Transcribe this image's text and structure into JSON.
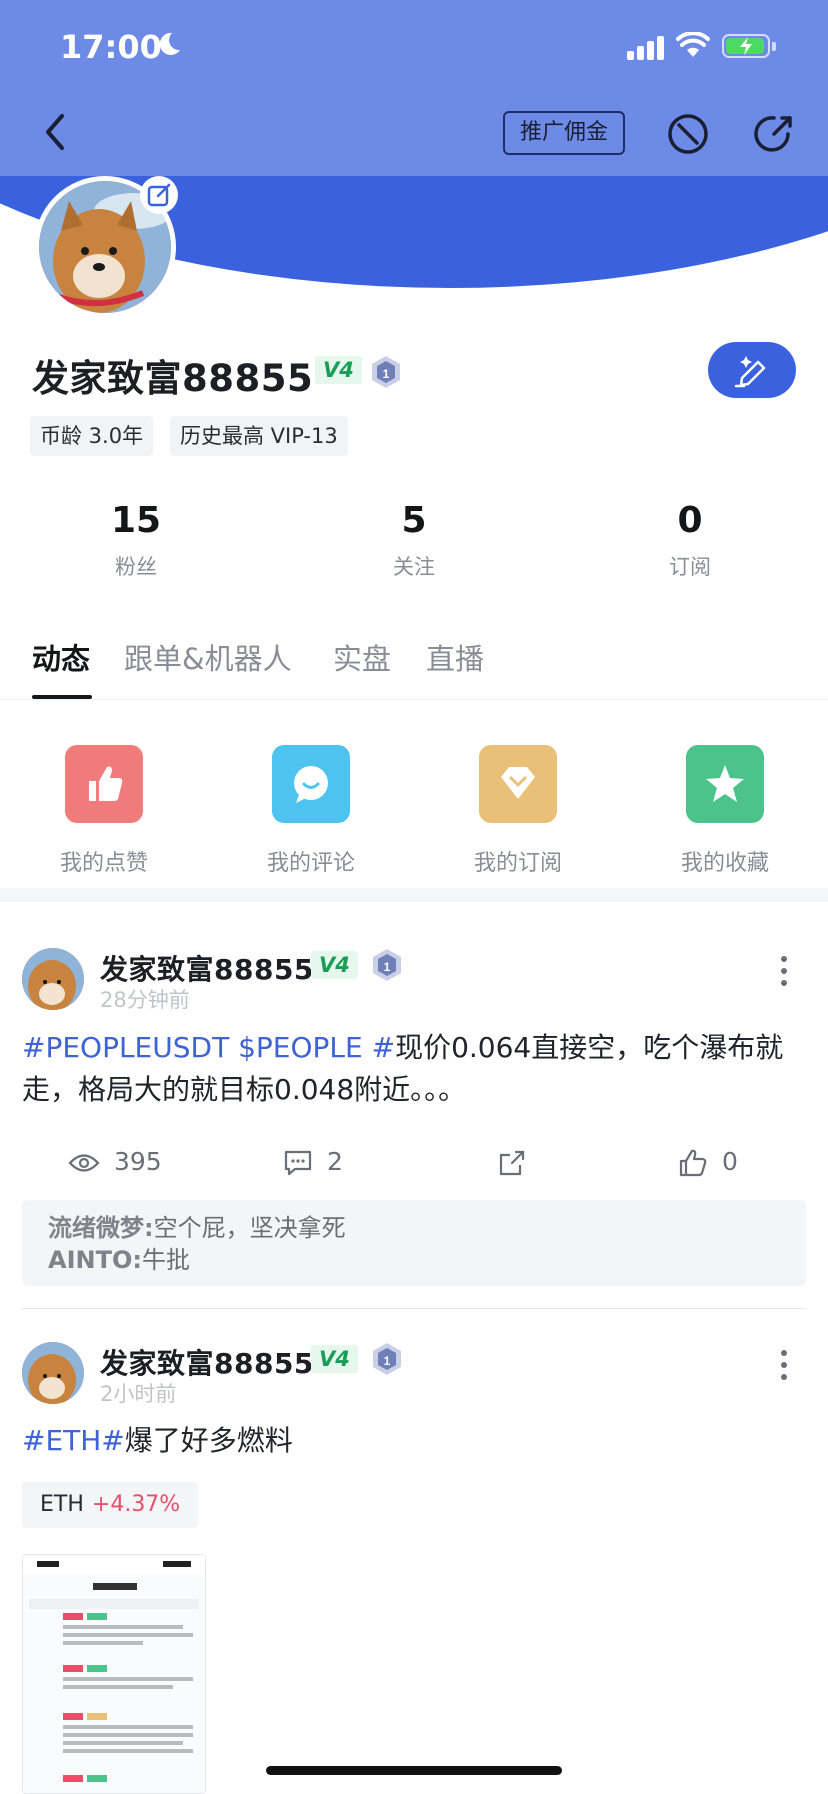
{
  "status_bar": {
    "time": "17:00"
  },
  "header": {
    "promo_label": "推广佣金"
  },
  "profile": {
    "name": "发家致富88855",
    "vip_badge": "V4",
    "level": "1",
    "tags": [
      "币龄 3.0年",
      "历史最高 VIP-13"
    ],
    "stats": [
      {
        "value": "15",
        "label": "粉丝"
      },
      {
        "value": "5",
        "label": "关注"
      },
      {
        "value": "0",
        "label": "订阅"
      }
    ]
  },
  "tabs": [
    "动态",
    "跟单&机器人",
    "实盘",
    "直播"
  ],
  "quick_actions": [
    {
      "label": "我的点赞",
      "color": "#f07b7b",
      "icon": "thumbs-up-icon"
    },
    {
      "label": "我的评论",
      "color": "#4fc3f0",
      "icon": "chat-bubble-icon"
    },
    {
      "label": "我的订阅",
      "color": "#e8c078",
      "icon": "diamond-icon"
    },
    {
      "label": "我的收藏",
      "color": "#4cc38a",
      "icon": "star-icon"
    }
  ],
  "posts": [
    {
      "author": "发家致富88855",
      "badge": "V4",
      "level": "1",
      "time": "28分钟前",
      "text_parts": [
        "#PEOPLEUSDT $PEOPLE #",
        "现价0.064直接空，吃个瀑布就走，格局大的就目标0.048附近。。。"
      ],
      "views": "395",
      "comments": "2",
      "likes": "0",
      "comment_list": [
        {
          "user": "流绪微梦:",
          "text": "空个屁，坚决拿死"
        },
        {
          "user": "AINTO:",
          "text": "牛批"
        }
      ]
    },
    {
      "author": "发家致富88855",
      "badge": "V4",
      "level": "1",
      "time": "2小时前",
      "text_parts": [
        "#ETH#",
        "爆了好多燃料"
      ],
      "coin": {
        "symbol": "ETH",
        "change": "+4.37%"
      }
    }
  ],
  "colors": {
    "brand": "#3a62df",
    "header": "#6d8ae6",
    "up": "#e84e6a",
    "vip": "#1c9c59"
  }
}
